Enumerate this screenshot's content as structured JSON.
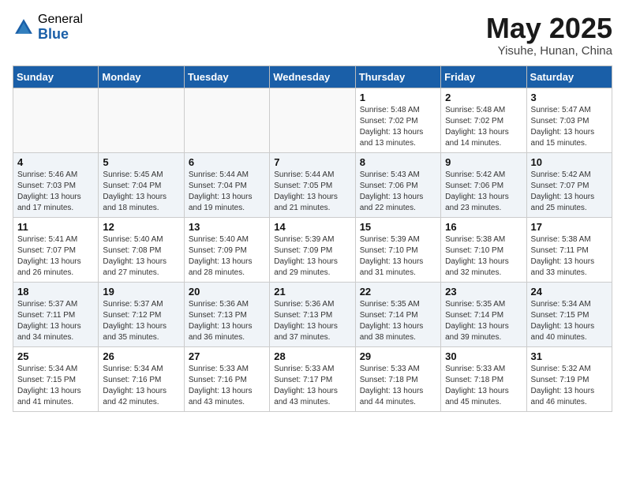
{
  "header": {
    "logo_general": "General",
    "logo_blue": "Blue",
    "month_title": "May 2025",
    "location": "Yisuhe, Hunan, China"
  },
  "days_of_week": [
    "Sunday",
    "Monday",
    "Tuesday",
    "Wednesday",
    "Thursday",
    "Friday",
    "Saturday"
  ],
  "weeks": [
    [
      {
        "day": "",
        "info": ""
      },
      {
        "day": "",
        "info": ""
      },
      {
        "day": "",
        "info": ""
      },
      {
        "day": "",
        "info": ""
      },
      {
        "day": "1",
        "info": "Sunrise: 5:48 AM\nSunset: 7:02 PM\nDaylight: 13 hours\nand 13 minutes."
      },
      {
        "day": "2",
        "info": "Sunrise: 5:48 AM\nSunset: 7:02 PM\nDaylight: 13 hours\nand 14 minutes."
      },
      {
        "day": "3",
        "info": "Sunrise: 5:47 AM\nSunset: 7:03 PM\nDaylight: 13 hours\nand 15 minutes."
      }
    ],
    [
      {
        "day": "4",
        "info": "Sunrise: 5:46 AM\nSunset: 7:03 PM\nDaylight: 13 hours\nand 17 minutes."
      },
      {
        "day": "5",
        "info": "Sunrise: 5:45 AM\nSunset: 7:04 PM\nDaylight: 13 hours\nand 18 minutes."
      },
      {
        "day": "6",
        "info": "Sunrise: 5:44 AM\nSunset: 7:04 PM\nDaylight: 13 hours\nand 19 minutes."
      },
      {
        "day": "7",
        "info": "Sunrise: 5:44 AM\nSunset: 7:05 PM\nDaylight: 13 hours\nand 21 minutes."
      },
      {
        "day": "8",
        "info": "Sunrise: 5:43 AM\nSunset: 7:06 PM\nDaylight: 13 hours\nand 22 minutes."
      },
      {
        "day": "9",
        "info": "Sunrise: 5:42 AM\nSunset: 7:06 PM\nDaylight: 13 hours\nand 23 minutes."
      },
      {
        "day": "10",
        "info": "Sunrise: 5:42 AM\nSunset: 7:07 PM\nDaylight: 13 hours\nand 25 minutes."
      }
    ],
    [
      {
        "day": "11",
        "info": "Sunrise: 5:41 AM\nSunset: 7:07 PM\nDaylight: 13 hours\nand 26 minutes."
      },
      {
        "day": "12",
        "info": "Sunrise: 5:40 AM\nSunset: 7:08 PM\nDaylight: 13 hours\nand 27 minutes."
      },
      {
        "day": "13",
        "info": "Sunrise: 5:40 AM\nSunset: 7:09 PM\nDaylight: 13 hours\nand 28 minutes."
      },
      {
        "day": "14",
        "info": "Sunrise: 5:39 AM\nSunset: 7:09 PM\nDaylight: 13 hours\nand 29 minutes."
      },
      {
        "day": "15",
        "info": "Sunrise: 5:39 AM\nSunset: 7:10 PM\nDaylight: 13 hours\nand 31 minutes."
      },
      {
        "day": "16",
        "info": "Sunrise: 5:38 AM\nSunset: 7:10 PM\nDaylight: 13 hours\nand 32 minutes."
      },
      {
        "day": "17",
        "info": "Sunrise: 5:38 AM\nSunset: 7:11 PM\nDaylight: 13 hours\nand 33 minutes."
      }
    ],
    [
      {
        "day": "18",
        "info": "Sunrise: 5:37 AM\nSunset: 7:11 PM\nDaylight: 13 hours\nand 34 minutes."
      },
      {
        "day": "19",
        "info": "Sunrise: 5:37 AM\nSunset: 7:12 PM\nDaylight: 13 hours\nand 35 minutes."
      },
      {
        "day": "20",
        "info": "Sunrise: 5:36 AM\nSunset: 7:13 PM\nDaylight: 13 hours\nand 36 minutes."
      },
      {
        "day": "21",
        "info": "Sunrise: 5:36 AM\nSunset: 7:13 PM\nDaylight: 13 hours\nand 37 minutes."
      },
      {
        "day": "22",
        "info": "Sunrise: 5:35 AM\nSunset: 7:14 PM\nDaylight: 13 hours\nand 38 minutes."
      },
      {
        "day": "23",
        "info": "Sunrise: 5:35 AM\nSunset: 7:14 PM\nDaylight: 13 hours\nand 39 minutes."
      },
      {
        "day": "24",
        "info": "Sunrise: 5:34 AM\nSunset: 7:15 PM\nDaylight: 13 hours\nand 40 minutes."
      }
    ],
    [
      {
        "day": "25",
        "info": "Sunrise: 5:34 AM\nSunset: 7:15 PM\nDaylight: 13 hours\nand 41 minutes."
      },
      {
        "day": "26",
        "info": "Sunrise: 5:34 AM\nSunset: 7:16 PM\nDaylight: 13 hours\nand 42 minutes."
      },
      {
        "day": "27",
        "info": "Sunrise: 5:33 AM\nSunset: 7:16 PM\nDaylight: 13 hours\nand 43 minutes."
      },
      {
        "day": "28",
        "info": "Sunrise: 5:33 AM\nSunset: 7:17 PM\nDaylight: 13 hours\nand 43 minutes."
      },
      {
        "day": "29",
        "info": "Sunrise: 5:33 AM\nSunset: 7:18 PM\nDaylight: 13 hours\nand 44 minutes."
      },
      {
        "day": "30",
        "info": "Sunrise: 5:33 AM\nSunset: 7:18 PM\nDaylight: 13 hours\nand 45 minutes."
      },
      {
        "day": "31",
        "info": "Sunrise: 5:32 AM\nSunset: 7:19 PM\nDaylight: 13 hours\nand 46 minutes."
      }
    ]
  ]
}
